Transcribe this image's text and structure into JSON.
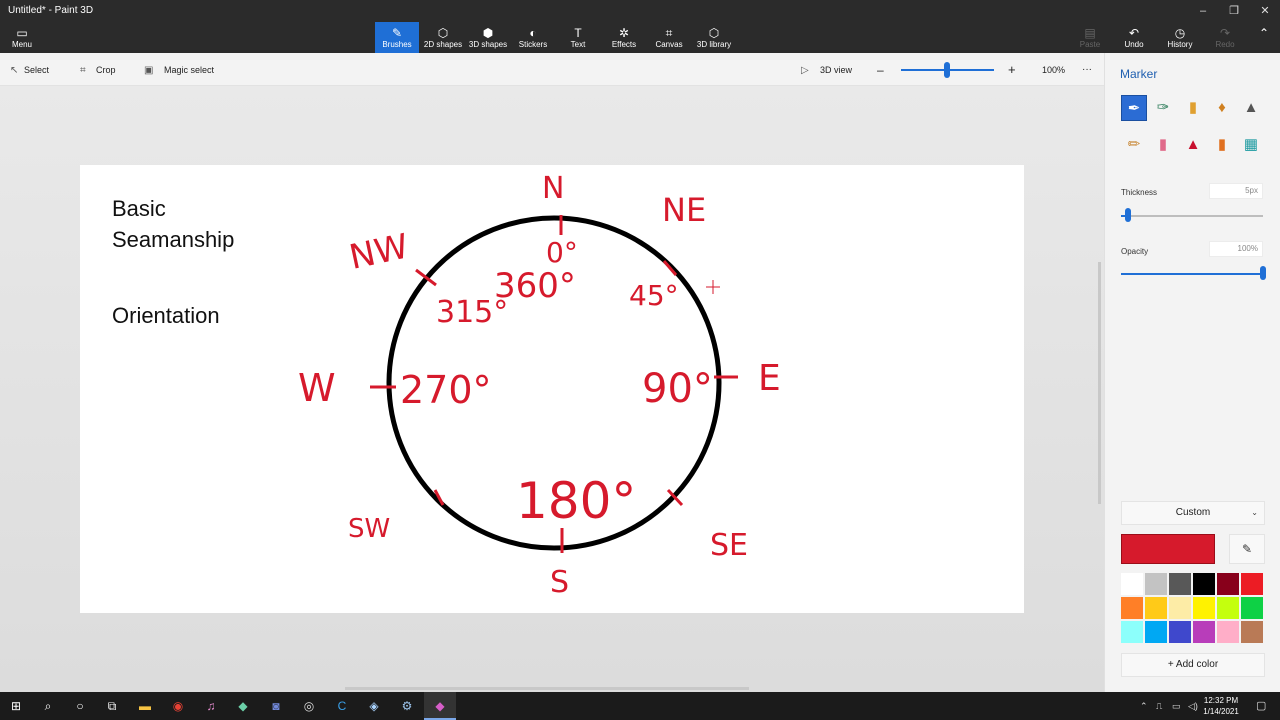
{
  "window": {
    "title": "Untitled* - Paint 3D",
    "controls": [
      "–",
      "❐",
      "✕"
    ]
  },
  "ribbon": {
    "menu": {
      "label": "Menu",
      "icon": "▭"
    },
    "tools": [
      {
        "label": "Brushes",
        "icon": "✎",
        "active": true
      },
      {
        "label": "2D shapes",
        "icon": "⬡"
      },
      {
        "label": "3D shapes",
        "icon": "⬢"
      },
      {
        "label": "Stickers",
        "icon": "◐"
      },
      {
        "label": "Text",
        "icon": "T"
      },
      {
        "label": "Effects",
        "icon": "✲"
      },
      {
        "label": "Canvas",
        "icon": "⌗"
      },
      {
        "label": "3D library",
        "icon": "⬡"
      }
    ],
    "actions": [
      {
        "label": "Paste",
        "icon": "▤",
        "enabled": false
      },
      {
        "label": "Undo",
        "icon": "↶",
        "enabled": true
      },
      {
        "label": "History",
        "icon": "◷",
        "enabled": true
      },
      {
        "label": "Redo",
        "icon": "↷",
        "enabled": false
      }
    ],
    "collapse_icon": "⌃"
  },
  "toolbar": {
    "select": "Select",
    "crop": "Crop",
    "magic_select": "Magic select",
    "view_3d": "3D view",
    "zoom_minus": "–",
    "zoom_plus": "+",
    "zoom_level": "100%",
    "more": "···"
  },
  "canvas_text": {
    "line1": "Basic",
    "line2": "Seamanship",
    "line3": "Orientation"
  },
  "compass": {
    "directions": [
      "N",
      "NE",
      "E",
      "SE",
      "S",
      "SW",
      "W",
      "NW"
    ],
    "angles": [
      "0°",
      "360°",
      "45°",
      "90°",
      "180°",
      "270°",
      "315°"
    ]
  },
  "panel": {
    "title": "Marker",
    "thickness_label": "Thickness",
    "thickness_value": "5px",
    "thickness_level": 0.05,
    "opacity_label": "Opacity",
    "opacity_value": "100%",
    "opacity_level": 1.0,
    "color_mode": "Custom",
    "current_color": "#d61a2c",
    "add_color": "Add color",
    "palette": [
      "#ffffff",
      "#c3c3c3",
      "#585858",
      "#000000",
      "#88001b",
      "#ec1c24",
      "#ff7f27",
      "#ffca18",
      "#fdeca6",
      "#fff200",
      "#c4ff0e",
      "#0ed145",
      "#8cfffb",
      "#00a8f3",
      "#3f48cc",
      "#b83dba",
      "#ffaec8",
      "#b97a56"
    ]
  },
  "taskbar": {
    "time": "12:32 PM",
    "date": "1/14/2021"
  }
}
